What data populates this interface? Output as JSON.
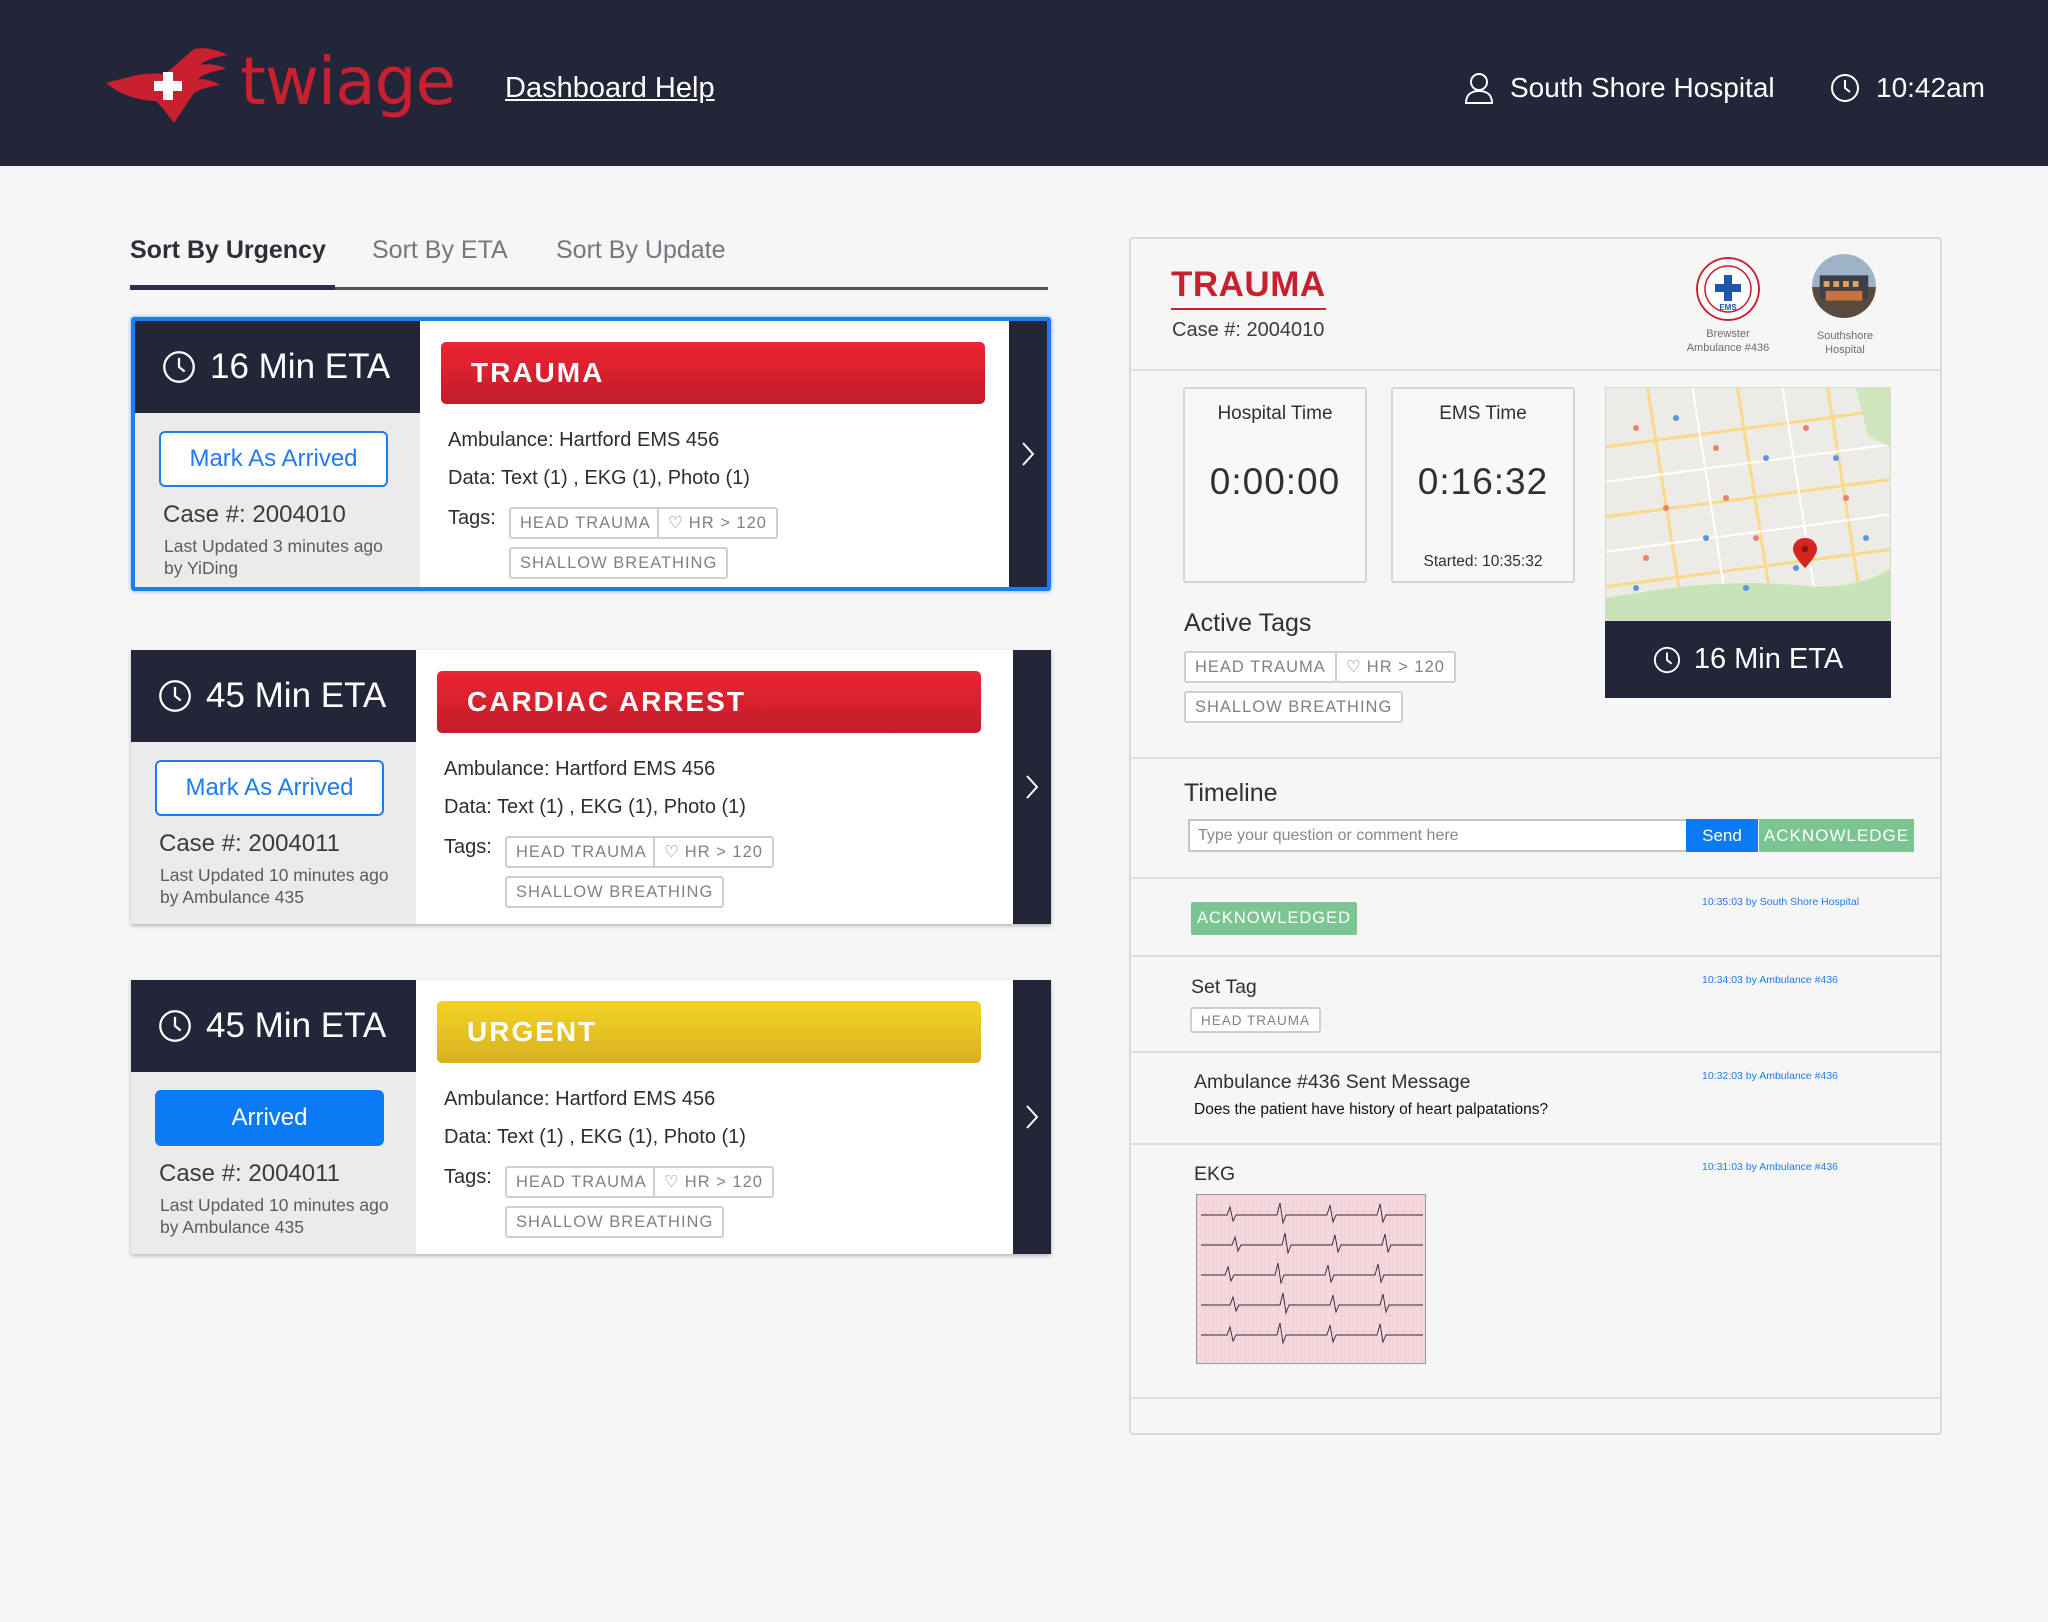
{
  "header": {
    "brand": "twiage",
    "help_link": "Dashboard Help",
    "hospital": "South Shore Hospital",
    "time": "10:42am"
  },
  "sort_tabs": [
    {
      "label": "Sort By Urgency",
      "active": true
    },
    {
      "label": "Sort By ETA",
      "active": false
    },
    {
      "label": "Sort By Update",
      "active": false
    }
  ],
  "cases": [
    {
      "eta": "16 Min ETA",
      "button": "Mark As Arrived",
      "case": "Case #: 2004010",
      "updated": "Last Updated 3 minutes ago by YiDing",
      "category": "TRAUMA",
      "ambulance": "Ambulance: Hartford EMS 456",
      "data": "Data: Text (1) , EKG (1), Photo (1)",
      "tags_label": "Tags:",
      "tags": [
        "HEAD TRAUMA",
        "HR > 120",
        "SHALLOW BREATHING"
      ]
    },
    {
      "eta": "45 Min ETA",
      "button": "Mark As Arrived",
      "case": "Case #: 2004011",
      "updated": "Last Updated 10 minutes ago by Ambulance 435",
      "category": "CARDIAC ARREST",
      "ambulance": "Ambulance: Hartford EMS 456",
      "data": "Data: Text (1) , EKG (1), Photo (1)",
      "tags_label": "Tags:",
      "tags": [
        "HEAD TRAUMA",
        "HR > 120",
        "SHALLOW BREATHING"
      ]
    },
    {
      "eta": "45 Min ETA",
      "button": "Arrived",
      "case": "Case #: 2004011",
      "updated": "Last Updated 10 minutes ago by Ambulance 435",
      "category": "URGENT",
      "ambulance": "Ambulance: Hartford EMS 456",
      "data": "Data: Text (1) , EKG (1), Photo (1)",
      "tags_label": "Tags:",
      "tags": [
        "HEAD TRAUMA",
        "HR > 120",
        "SHALLOW BREATHING"
      ]
    }
  ],
  "colors": {
    "navy": "#232639",
    "brand_red": "#c8202e",
    "trauma_red": "#e02030",
    "urgent_yellow": "#e8c423",
    "accent_blue": "#0a7bf4",
    "ack_green": "#7bc593"
  },
  "detail": {
    "title": "TRAUMA",
    "case": "Case #: 2004010",
    "logo_ems_text": "EMS",
    "logo_ems_label_1": "Brewster",
    "logo_ems_label_2": "Ambulance #436",
    "logo_hosp_label_1": "Southshore",
    "logo_hosp_label_2": "Hospital",
    "hospital_time_label": "Hospital Time",
    "hospital_time": "0:00:00",
    "ems_time_label": "EMS Time",
    "ems_time": "0:16:32",
    "ems_started": "Started: 10:35:32",
    "active_tags_title": "Active Tags",
    "active_tags": [
      "HEAD TRAUMA",
      "HR > 120",
      "SHALLOW BREATHING"
    ],
    "map_eta": "16 Min ETA",
    "timeline_title": "Timeline",
    "comment_placeholder": "Type your question or comment here",
    "send_label": "Send",
    "acknowledge_label": "ACKNOWLEDGE",
    "timeline": [
      {
        "meta": "10:35:03 by South Shore Hospital",
        "pill": "ACKNOWLEDGED"
      },
      {
        "meta": "10:34:03 by Ambulance #436",
        "title": "Set Tag",
        "tag": "HEAD TRAUMA"
      },
      {
        "meta": "10:32:03 by Ambulance #436",
        "title": "Ambulance #436 Sent Message",
        "message": "Does the patient have history of heart palpatations?"
      },
      {
        "meta": "10:31:03 by Ambulance #436",
        "title": "EKG"
      }
    ]
  }
}
